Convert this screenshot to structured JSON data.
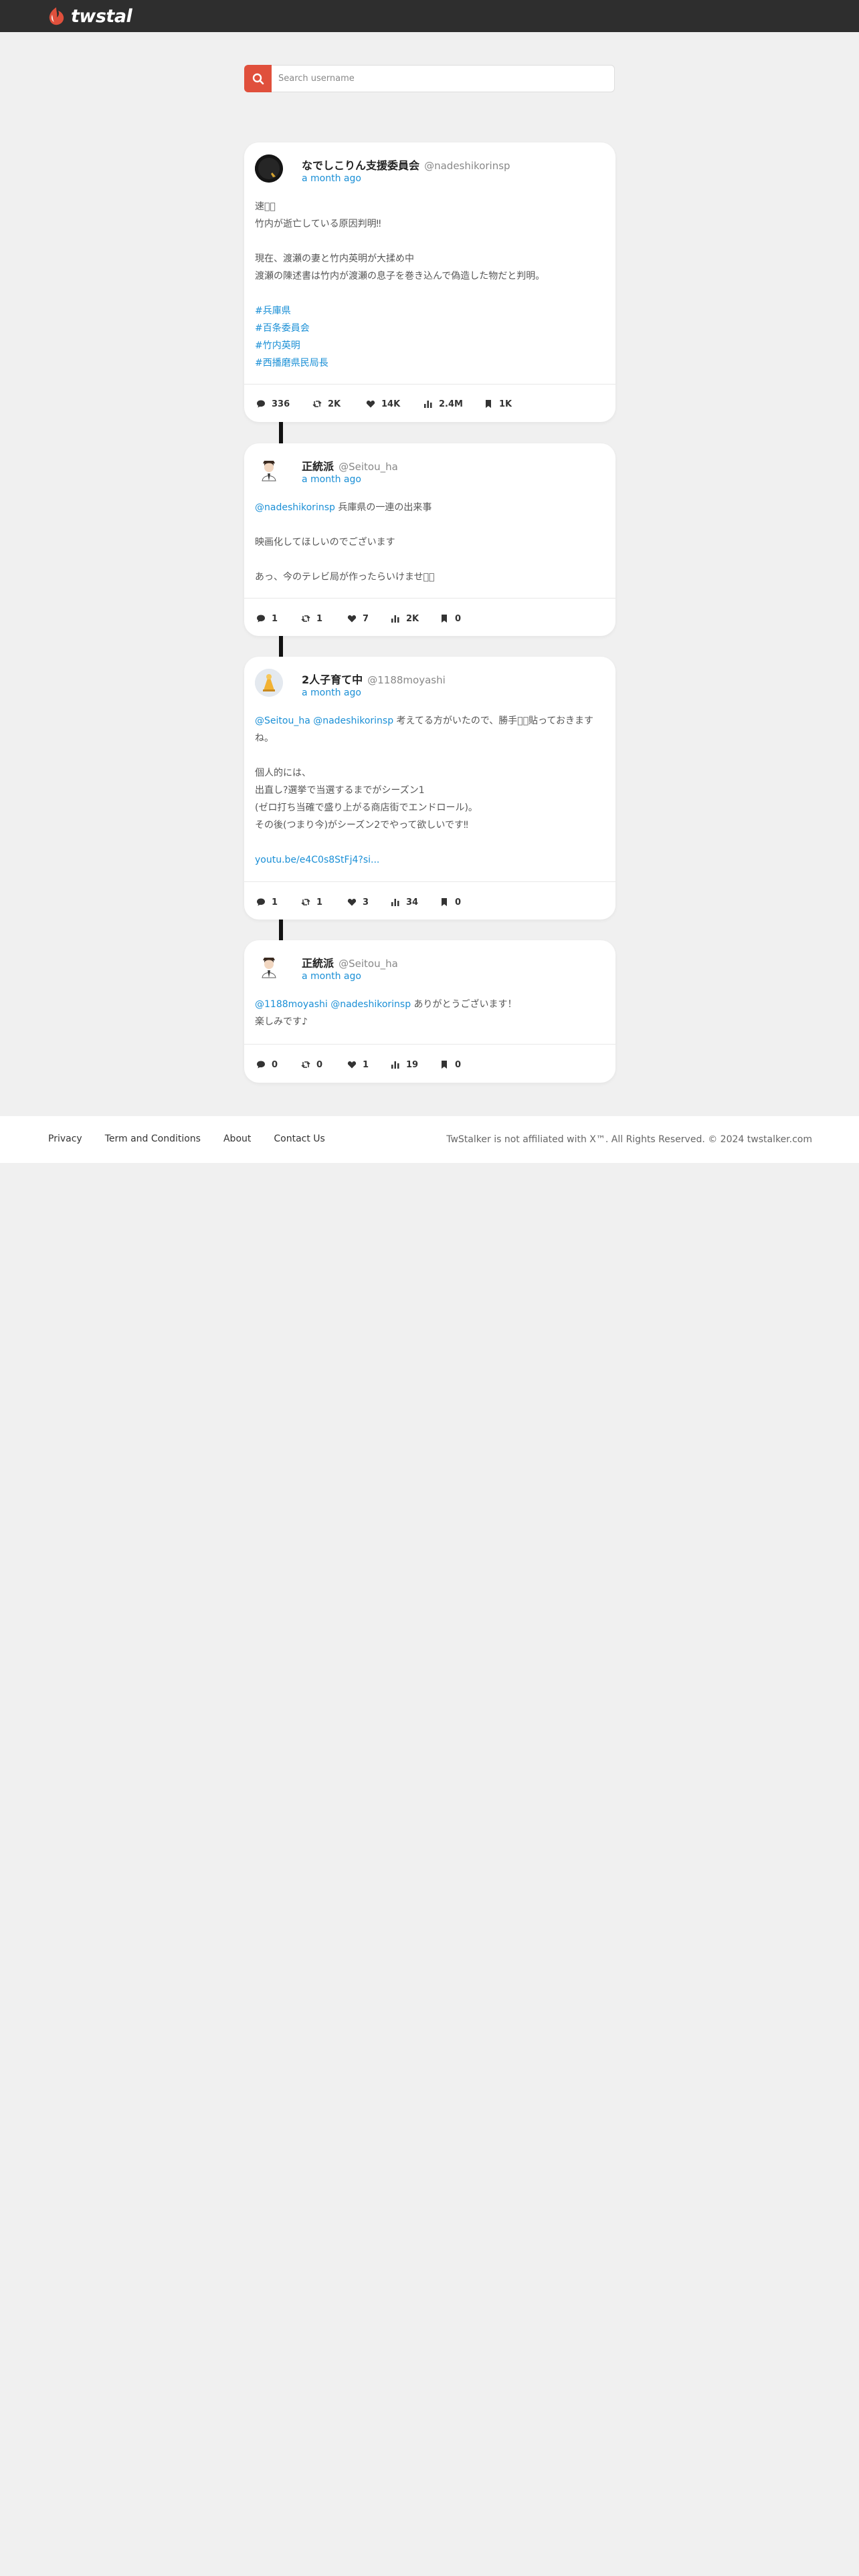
{
  "header": {
    "logo_text": "twstalker"
  },
  "search": {
    "placeholder": "Search username"
  },
  "posts": [
    {
      "name": "なでしこりん支援委員会",
      "handle": "@nadeshikorinsp",
      "time": "a month ago",
      "lines": [
        {
          "text": "速報⃣",
          "link": false
        },
        {
          "text": "竹内が逝亡している原因判明‼",
          "link": false
        },
        {
          "text": "",
          "link": false
        },
        {
          "text": "現在、渡瀬の妻と竹内英明が大揉め中",
          "link": false
        },
        {
          "text": "渡瀬の陳述書は竹内が渡瀬の息子を巻き込んで偽造した物だと判明。",
          "link": false
        },
        {
          "text": "",
          "link": false
        },
        {
          "text": "#兵庫県",
          "link": true
        },
        {
          "text": "#百条委員会",
          "link": true
        },
        {
          "text": "#竹内英明",
          "link": true
        },
        {
          "text": "#西播磨県民局長",
          "link": true
        }
      ],
      "stats": {
        "replies": "336",
        "retweets": "2K",
        "likes": "14K",
        "views": "2.4M",
        "bookmarks": "1K"
      }
    },
    {
      "name": "正統派",
      "handle": "@Seitou_ha",
      "time": "a month ago",
      "lines": [
        {
          "mention": "@nadeshikorinsp",
          "text": " 兵庫県の一連の出来事"
        },
        {
          "text": ""
        },
        {
          "text": "映画化してほしいのでございます"
        },
        {
          "text": ""
        },
        {
          "text": "あっ、今のテレビ局が作ったらいけませね⃣"
        }
      ],
      "stats": {
        "replies": "1",
        "retweets": "1",
        "likes": "7",
        "views": "2K",
        "bookmarks": "0"
      }
    },
    {
      "name": "2人子育て中",
      "handle": "@1188moyashi",
      "time": "a month ago",
      "lines": [
        {
          "mention": "@Seitou_ha @nadeshikorinsp",
          "text": " 考えてる方がいたので、勝手に⃣貼っておきます"
        },
        {
          "text": "ね。"
        },
        {
          "text": ""
        },
        {
          "text": "個人的には、"
        },
        {
          "text": "出直し?選挙で当選するまでがシーズン1"
        },
        {
          "text": "(ゼロ打ち当確で盛り上がる商店街でエンドロール)。"
        },
        {
          "text": "その後(つまり今)がシーズン2でやって欲しいです‼"
        },
        {
          "text": ""
        },
        {
          "link": "youtu.be/e4C0s8StFj4?si..."
        }
      ],
      "stats": {
        "replies": "1",
        "retweets": "1",
        "likes": "3",
        "views": "34",
        "bookmarks": "0"
      }
    },
    {
      "name": "正統派",
      "handle": "@Seitou_ha",
      "time": "a month ago",
      "lines": [
        {
          "mention": "@1188moyashi @nadeshikorinsp",
          "text": " ありがとうございます！"
        },
        {
          "text": "楽しみです♪"
        }
      ],
      "stats": {
        "replies": "0",
        "retweets": "0",
        "likes": "1",
        "views": "19",
        "bookmarks": "0"
      }
    }
  ],
  "footer": {
    "links": [
      "Privacy",
      "Term and Conditions",
      "About",
      "Contact Us"
    ],
    "copyright": "TwStalker is not affiliated with X™. All Rights Reserved. © 2024 twstalker.com"
  },
  "colors": {
    "accent": "#e0503c",
    "link": "#1a8fd6",
    "topbar": "#2e2e2e",
    "background": "#f0f0f0"
  },
  "icons": {
    "search": "search-icon",
    "reply": "comment-icon",
    "retweet": "retweet-icon",
    "like": "heart-icon",
    "views": "bar-chart-icon",
    "bookmark": "bookmark-icon"
  }
}
